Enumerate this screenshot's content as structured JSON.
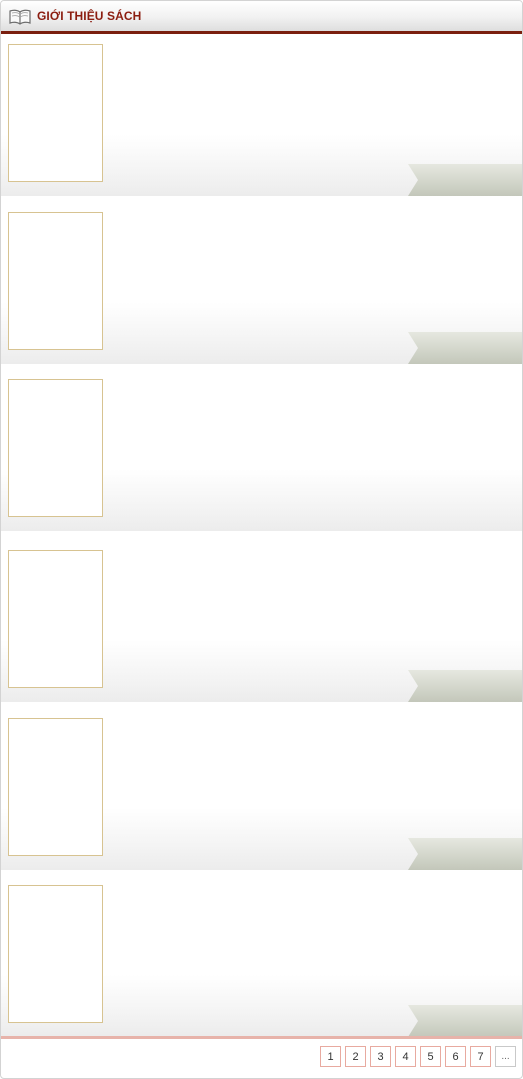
{
  "header": {
    "title": "GIỚI THIỆU SÁCH",
    "icon": "open-book-icon"
  },
  "items": [
    {
      "has_ribbon": true
    },
    {
      "has_ribbon": true
    },
    {
      "has_ribbon": false
    },
    {
      "has_ribbon": true
    },
    {
      "has_ribbon": true
    },
    {
      "has_ribbon": true
    }
  ],
  "pagination": {
    "pages": [
      "1",
      "2",
      "3",
      "4",
      "5",
      "6",
      "7"
    ],
    "more": "..."
  },
  "colors": {
    "title": "#8b1d10",
    "header_border": "#7a1f0e",
    "thumb_border": "#d7c391",
    "ribbon": "#c8ccc0",
    "pager_border": "#e8aaa0"
  }
}
